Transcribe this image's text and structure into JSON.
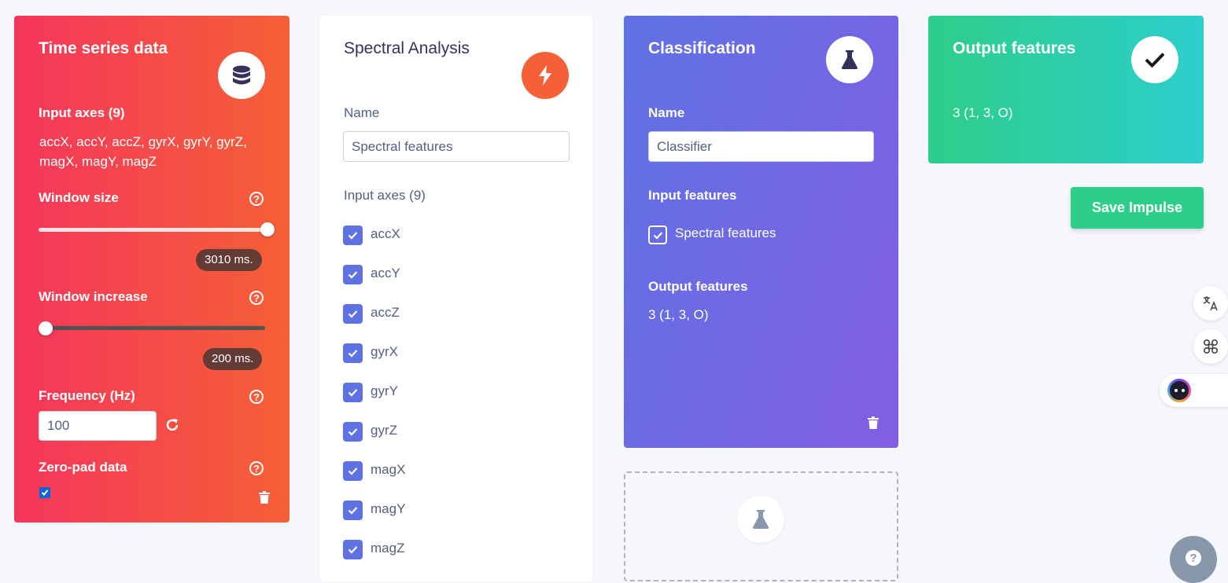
{
  "time_series": {
    "title": "Time series data",
    "icon": "database-icon",
    "input_axes_label": "Input axes (9)",
    "axes_line1": "accX, accY, accZ, gyrX, gyrY, gyrZ,",
    "axes_line2": "magX, magY, magZ",
    "window_size_label": "Window size",
    "window_size_value": "3010 ms.",
    "window_increase_label": "Window increase",
    "window_increase_value": "200 ms.",
    "frequency_label": "Frequency (Hz)",
    "frequency_value": "100",
    "zero_pad_label": "Zero-pad data",
    "help_glyph": "?"
  },
  "spectral": {
    "title": "Spectral Analysis",
    "icon": "lightning-icon",
    "name_label": "Name",
    "name_value": "Spectral features",
    "input_axes_label": "Input axes (9)",
    "axes": [
      "accX",
      "accY",
      "accZ",
      "gyrX",
      "gyrY",
      "gyrZ",
      "magX",
      "magY",
      "magZ"
    ]
  },
  "classification": {
    "title": "Classification",
    "icon": "flask-icon",
    "name_label": "Name",
    "name_value": "Classifier",
    "input_features_label": "Input features",
    "input_feature": "Spectral features",
    "output_features_label": "Output features",
    "output_features_value": "3 (1, 3, O)"
  },
  "output": {
    "title": "Output features",
    "icon": "checkmark-icon",
    "value": "3 (1, 3, O)"
  },
  "save_button": "Save Impulse",
  "colors": {
    "time_series": "#f5365c",
    "spectral_icon": "#f56036",
    "classification": "#5e72e4",
    "output": "#2dce89",
    "save_button": "#2dce89"
  }
}
